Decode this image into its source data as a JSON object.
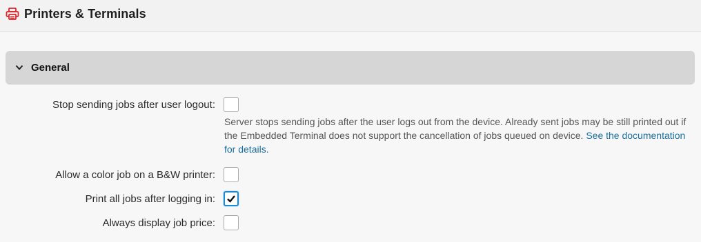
{
  "header": {
    "title": "Printers & Terminals",
    "icon": "printer-icon",
    "icon_color": "#d9262b"
  },
  "section": {
    "title": "General",
    "icon": "chevron-down-icon"
  },
  "settings": [
    {
      "label": "Stop sending jobs after user logout:",
      "checked": false
    },
    {
      "label": "Allow a color job on a B&W printer:",
      "checked": false
    },
    {
      "label": "Print all jobs after logging in:",
      "checked": true
    },
    {
      "label": "Always display job price:",
      "checked": false
    }
  ],
  "description": {
    "text": "Server stops sending jobs after the user logs out from the device. Already sent jobs may be still printed out if the Embedded Terminal does not support the cancellation of jobs queued on device. ",
    "link": "See the documentation for details."
  },
  "colors": {
    "accent": "#1c8ad0",
    "link": "#1a6e9c",
    "section_bg": "#d6d6d6"
  }
}
